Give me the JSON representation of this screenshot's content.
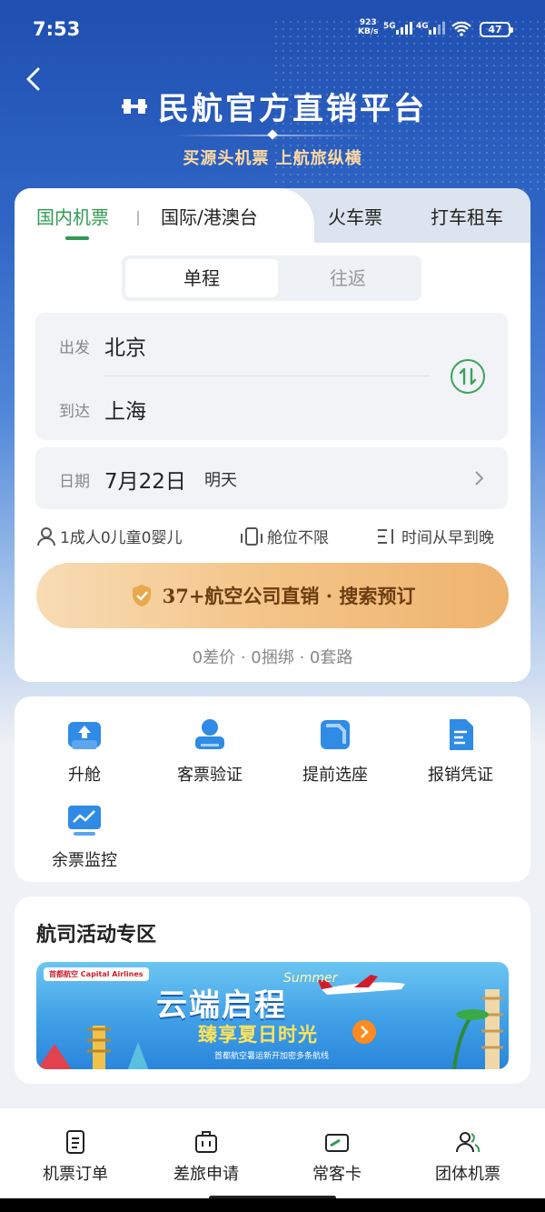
{
  "status": {
    "time": "7:53",
    "speed": "923",
    "speed_unit": "KB/s",
    "net1": "5G",
    "net2": "4G",
    "battery": "47"
  },
  "header": {
    "title": "民航官方直销平台",
    "slogan": "买源头机票 上航旅纵横"
  },
  "tabs": [
    {
      "label": "国内机票",
      "active": true
    },
    {
      "label": "国际/港澳台",
      "active": false
    },
    {
      "label": "火车票",
      "active": false
    },
    {
      "label": "打车租车",
      "active": false
    }
  ],
  "trip_type": {
    "one_way": "单程",
    "round_trip": "往返",
    "selected": "单程"
  },
  "route": {
    "from_label": "出发",
    "from_city": "北京",
    "to_label": "到达",
    "to_city": "上海"
  },
  "date": {
    "label": "日期",
    "value": "7月22日",
    "hint": "明天"
  },
  "options": {
    "passengers": "1成人0儿童0婴儿",
    "cabin": "舱位不限",
    "sort": "时间从早到晚"
  },
  "search_button": "37+航空公司直销 · 搜索预订",
  "guarantee": "0差价 · 0捆绑 · 0套路",
  "services": [
    {
      "label": "升舱",
      "icon": "upgrade-seat-icon"
    },
    {
      "label": "客票验证",
      "icon": "ticket-verify-icon"
    },
    {
      "label": "提前选座",
      "icon": "seat-select-icon"
    },
    {
      "label": "报销凭证",
      "icon": "receipt-icon"
    },
    {
      "label": "余票监控",
      "icon": "monitor-icon"
    }
  ],
  "activity": {
    "title": "航司活动专区",
    "banner": {
      "airline": "首都航空",
      "airline_en": "Capital Airlines",
      "headline": "云端启程",
      "script": "Summer",
      "subline": "臻享夏日时光",
      "note": "首都航空暑运新开加密多条航线"
    }
  },
  "bottom_nav": [
    {
      "label": "机票订单",
      "icon": "order-list-icon"
    },
    {
      "label": "差旅申请",
      "icon": "briefcase-icon"
    },
    {
      "label": "常客卡",
      "icon": "member-card-icon"
    },
    {
      "label": "团体机票",
      "icon": "group-icon"
    }
  ],
  "colors": {
    "primary_green": "#2e9b51",
    "hero_blue": "#2f66c6",
    "search_gold": "#f3c487",
    "service_blue": "#2f8be6"
  }
}
